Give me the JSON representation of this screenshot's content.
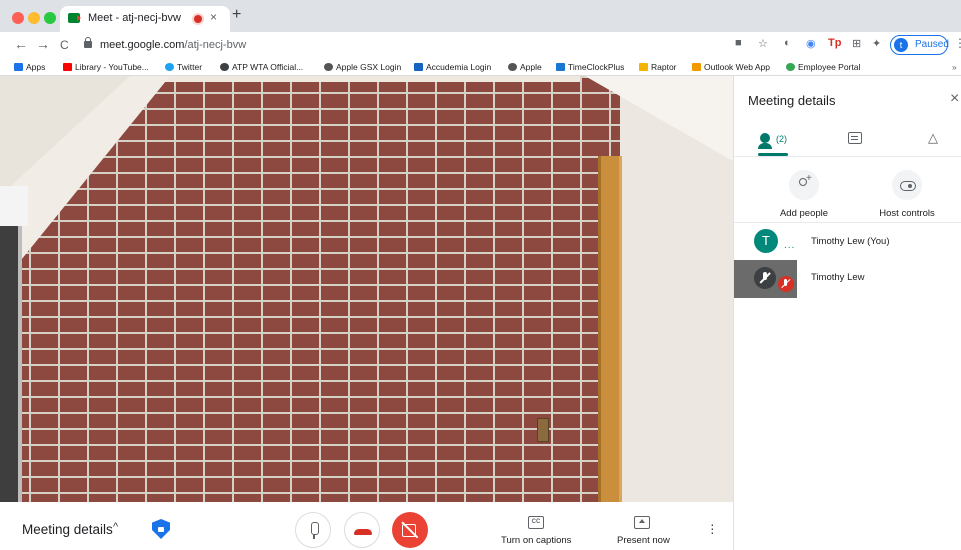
{
  "browser": {
    "tab_title": "Meet - atj-necj-bvw",
    "tab_close": "×",
    "new_tab": "+",
    "back": "←",
    "forward": "→",
    "reload": "C",
    "url_host": "meet.google.com",
    "url_path": "/atj-necj-bvw",
    "profile_initial": "t",
    "profile_status": "Paused",
    "menu": "⋮",
    "ext_icons": [
      "■",
      "☆",
      "◐",
      "◉",
      "Tp",
      "⊞",
      "✦"
    ]
  },
  "bookmarks": [
    {
      "label": "Apps",
      "color": "#1a73e8"
    },
    {
      "label": "Library - YouTube...",
      "color": "#ff0000"
    },
    {
      "label": "Twitter",
      "color": "#1da1f2"
    },
    {
      "label": "ATP WTA Official...",
      "color": "#3c4043"
    },
    {
      "label": "Apple GSX Login",
      "color": "#555555"
    },
    {
      "label": "Accudemia Login",
      "color": "#1565c0"
    },
    {
      "label": "Apple",
      "color": "#555555"
    },
    {
      "label": "TimeClockPlus",
      "color": "#1976d2"
    },
    {
      "label": "Raptor",
      "color": "#f4b400"
    },
    {
      "label": "Outlook Web App",
      "color": "#f29900"
    },
    {
      "label": "Employee Portal",
      "color": "#34a853"
    }
  ],
  "bookmarks_more": "»",
  "panel": {
    "title": "Meeting details",
    "close": "×",
    "people_count": "(2)",
    "activities_icon": "△ □○",
    "actions": [
      {
        "label": "Add people"
      },
      {
        "label": "Host controls"
      }
    ],
    "participants": [
      {
        "initial": "T",
        "name": "Timothy Lew (You)",
        "status": "..."
      },
      {
        "initial": "",
        "name": "Timothy Lew",
        "status": "muted"
      }
    ]
  },
  "bottombar": {
    "meeting_details": "Meeting details",
    "chevron": "^",
    "captions_icon_text": "CC",
    "captions_label": "Turn on captions",
    "present_label": "Present now",
    "more": "⋮"
  },
  "colors": {
    "accent_teal": "#00796b",
    "end_call_red": "#d93025",
    "camera_off_red": "#ea4335",
    "shield_blue": "#1a73e8"
  }
}
